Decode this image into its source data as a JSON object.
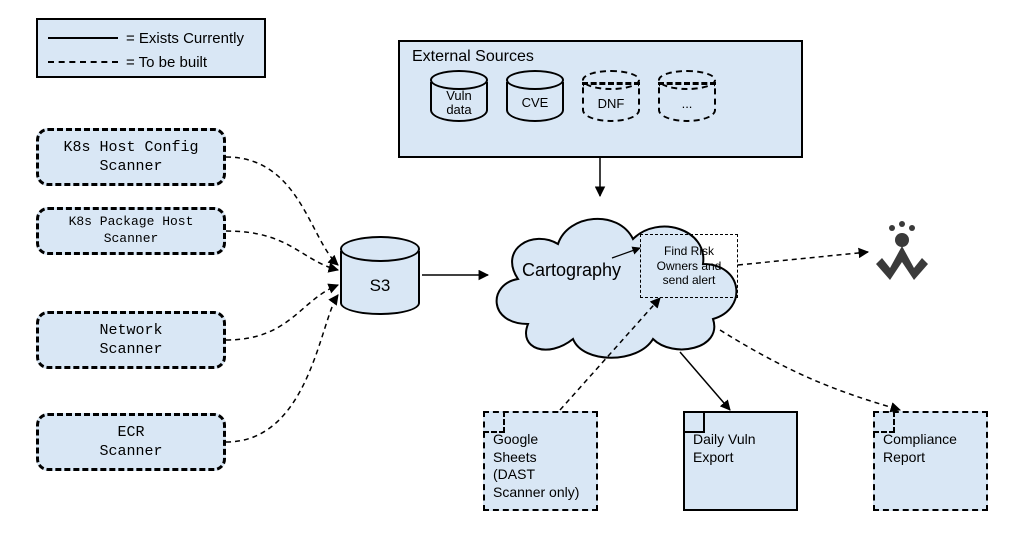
{
  "legend": {
    "exists_label": "= Exists Currently",
    "tobuild_label": "= To be built"
  },
  "scanners": {
    "k8s_host_config": "K8s Host Config\nScanner",
    "k8s_package_host": "K8s Package Host\nScanner",
    "network": "Network\nScanner",
    "ecr": "ECR\nScanner"
  },
  "external_sources": {
    "title": "External Sources",
    "items": {
      "vuln_data": "Vuln\ndata",
      "cve": "CVE",
      "dnf": "DNF",
      "more": "..."
    }
  },
  "s3_label": "S3",
  "cloud": {
    "title": "Cartography",
    "inner_action": "Find Risk\nOwners and\nsend alert"
  },
  "outputs": {
    "google_sheets": "Google\nSheets\n(DAST\nScanner only)",
    "daily_vuln": "Daily Vuln\nExport",
    "compliance": "Compliance\nReport"
  },
  "jira_icon_name": "jira"
}
